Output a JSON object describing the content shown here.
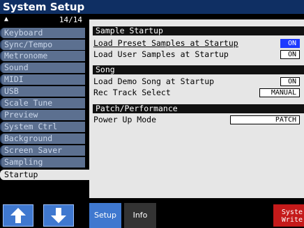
{
  "window": {
    "title": "System Setup"
  },
  "sidebar": {
    "position_indicator": "14/14",
    "items": [
      {
        "label": "Keyboard"
      },
      {
        "label": "Sync/Tempo"
      },
      {
        "label": "Metronome"
      },
      {
        "label": "Sound"
      },
      {
        "label": "MIDI"
      },
      {
        "label": "USB"
      },
      {
        "label": "Scale Tune"
      },
      {
        "label": "Preview"
      },
      {
        "label": "System Ctrl"
      },
      {
        "label": "Background"
      },
      {
        "label": "Screen Saver"
      },
      {
        "label": "Sampling"
      },
      {
        "label": "Startup",
        "active": true
      }
    ]
  },
  "main": {
    "sections": [
      {
        "title": "Sample   Startup",
        "rows": [
          {
            "label": "Load Preset Samples at Startup",
            "value": "ON",
            "selected": true
          },
          {
            "label": "Load User Samples at Startup",
            "value": "ON"
          }
        ]
      },
      {
        "title": "Song",
        "rows": [
          {
            "label": "Load Demo Song at Startup",
            "value": "ON"
          },
          {
            "label": "Rec Track Select",
            "value": "MANUAL"
          }
        ]
      },
      {
        "title": "Patch/Performance",
        "rows": [
          {
            "label": "Power Up Mode",
            "value": "PATCH"
          }
        ]
      }
    ]
  },
  "bottom": {
    "tabs": [
      {
        "label": "Setup",
        "active": true
      },
      {
        "label": "Info"
      }
    ],
    "system_write": {
      "line1": "Syste",
      "line2": "Write"
    },
    "up_button": "arrow-up-icon",
    "down_button": "arrow-down-icon"
  },
  "colors": {
    "title_bar": "#0f2f63",
    "sidebar_item": "#5c7090",
    "panel": "#e6e6e6",
    "selected_value": "#1d3aff",
    "tab_active": "#3f78cf",
    "system_write": "#c51a1a"
  }
}
